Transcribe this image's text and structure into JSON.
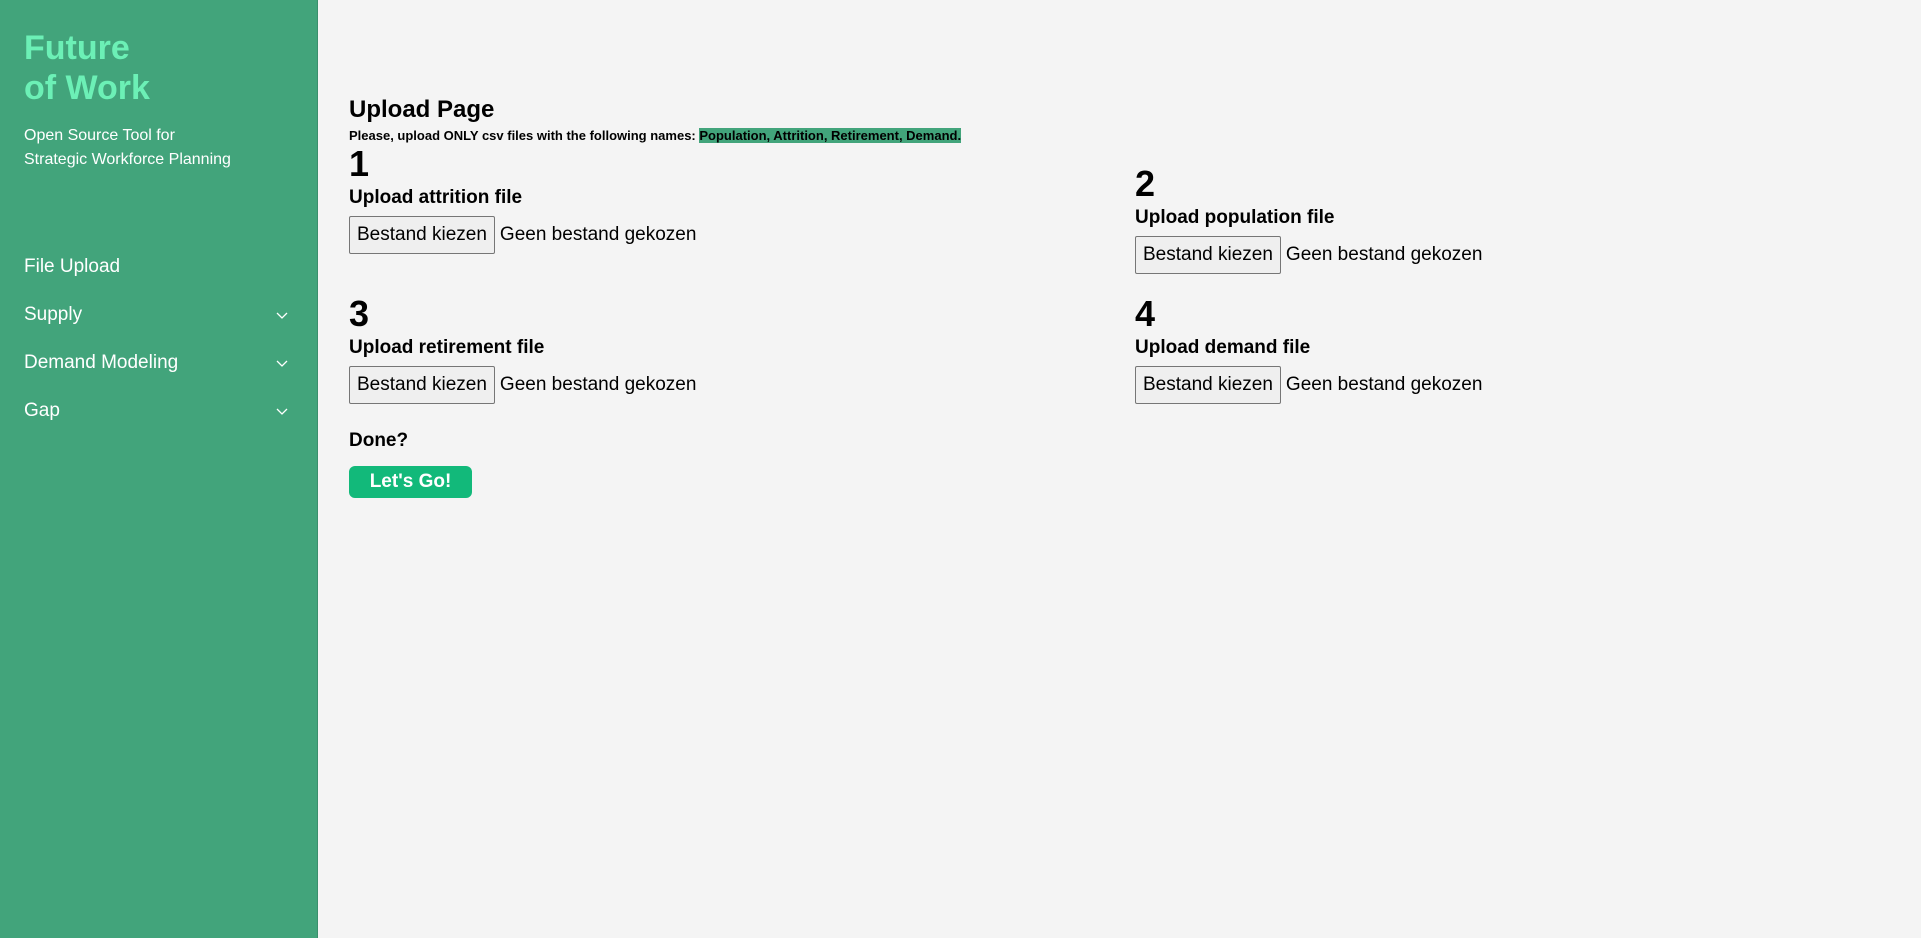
{
  "sidebar": {
    "brand_line1": "Future",
    "brand_line2": "of Work",
    "tagline_line1": "Open Source Tool for",
    "tagline_line2": "Strategic Workforce Planning",
    "items": [
      {
        "label": "File Upload",
        "has_chevron": false
      },
      {
        "label": "Supply",
        "has_chevron": true,
        "icon": "chevron-down-icon"
      },
      {
        "label": "Demand Modeling",
        "has_chevron": true,
        "icon": "chevron-down-icon"
      },
      {
        "label": "Gap",
        "has_chevron": true,
        "icon": "chevron-down-icon"
      }
    ]
  },
  "main": {
    "title": "Upload Page",
    "note_prefix": "Please, upload ONLY csv files with the following names: ",
    "note_highlight": "Population, Attrition, Retirement, Demand.",
    "uploads": [
      {
        "number": "1",
        "label": "Upload attrition file",
        "button": "Bestand kiezen",
        "status": "Geen bestand gekozen"
      },
      {
        "number": "2",
        "label": "Upload population file",
        "button": "Bestand kiezen",
        "status": "Geen bestand gekozen"
      },
      {
        "number": "3",
        "label": "Upload retirement file",
        "button": "Bestand kiezen",
        "status": "Geen bestand gekozen"
      },
      {
        "number": "4",
        "label": "Upload demand file",
        "button": "Bestand kiezen",
        "status": "Geen bestand gekozen"
      }
    ],
    "done_label": "Done?",
    "go_button": "Let's Go!"
  },
  "colors": {
    "sidebar_bg": "#42a47b",
    "brand": "#6cf0b6",
    "highlight": "#42a47b",
    "go_button": "#12b97a",
    "page_bg": "#f4f4f4"
  }
}
